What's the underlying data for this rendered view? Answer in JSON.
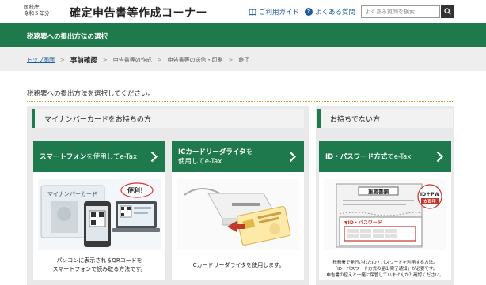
{
  "header": {
    "agency_line1": "国税庁",
    "agency_line2": "令和５年分",
    "site_title": "確定申告書等作成コーナー",
    "guide_link": "ご利用ガイド",
    "faq_link": "よくある質問",
    "search_placeholder": "よくある質問を検索"
  },
  "page_title": "税務署への提出方法の選択",
  "breadcrumb": [
    "トップ画面",
    "事前確認",
    "申告書等の作成",
    "申告書等の送信・印刷",
    "終了"
  ],
  "instruction": "税務署への提出方法を選択してください。",
  "sections": {
    "with_card": "マイナンバーカードをお持ちの方",
    "without_card": "お持ちでない方"
  },
  "cards": {
    "smartphone": {
      "title_bold": "スマートフォン",
      "title_rest": "を使用してe-Tax",
      "caption_line1": "パソコンに表示されるQRコードを",
      "caption_line2": "スマートフォンで読み取る方法です。",
      "illus_card_label": "マイナンバーカード",
      "illus_bubble": "便利！"
    },
    "icreader": {
      "title_line1": "ICカードリーダライタ",
      "title_line1_rest": "を",
      "title_line2": "使用してe-Tax",
      "caption_line1": "ICカードリーダライタを使用します。"
    },
    "idpw": {
      "title_bold": "ID・パスワード方式",
      "title_rest": "でe-Tax",
      "caption_line1": "税務署で発行されたID・パスワードを利用する方法。",
      "caption_line2": "「ID・パスワード方式の届出完了通知」が必要です。",
      "caption_line3": "申告書の控えと一緒に保管していませんか？確認ください。",
      "illus_doc_title": "重要書類",
      "illus_badge_line1": "ID＋PW",
      "illus_badge_line2": "が目印",
      "illus_idpw_label": "▼ID・パスワード"
    }
  },
  "colors": {
    "brand_green": "#1e7a4c",
    "link_blue": "#1a5a9c",
    "divider_orange": "#d99a2b"
  }
}
